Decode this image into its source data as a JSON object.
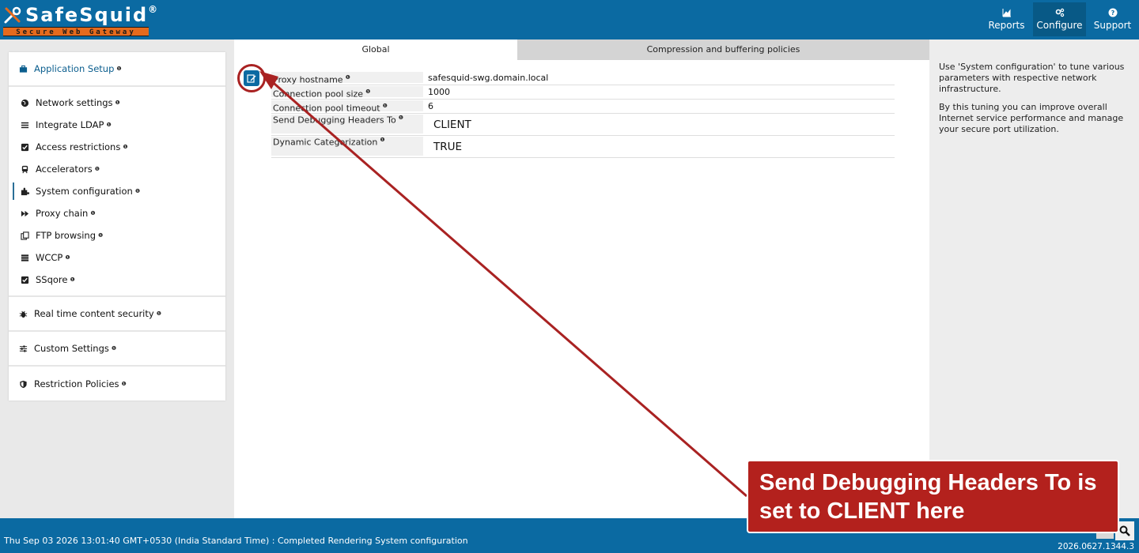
{
  "header": {
    "logo_title": "SafeSquid",
    "logo_reg": "®",
    "logo_subtitle": "Secure Web Gateway",
    "nav": [
      {
        "label": "Reports",
        "icon": "chart-icon"
      },
      {
        "label": "Configure",
        "icon": "cogs-icon",
        "active": true
      },
      {
        "label": "Support",
        "icon": "question-icon"
      }
    ]
  },
  "sidebar": {
    "app_setup": "Application Setup",
    "items": [
      {
        "label": "Network settings",
        "icon": "globe-icon"
      },
      {
        "label": "Integrate LDAP",
        "icon": "list-icon"
      },
      {
        "label": "Access restrictions",
        "icon": "checkbox-icon"
      },
      {
        "label": "Accelerators",
        "icon": "train-icon"
      },
      {
        "label": "System configuration",
        "icon": "puzzle-icon",
        "active": true
      },
      {
        "label": "Proxy chain",
        "icon": "fast-forward-icon"
      },
      {
        "label": "FTP browsing",
        "icon": "copy-icon"
      },
      {
        "label": "WCCP",
        "icon": "server-icon"
      },
      {
        "label": "SSqore",
        "icon": "checkbox-icon"
      }
    ],
    "realtime": "Real time content security",
    "custom": "Custom Settings",
    "restriction": "Restriction Policies"
  },
  "tabs": {
    "global": "Global",
    "compression": "Compression and buffering policies"
  },
  "config": {
    "rows": [
      {
        "label": "Proxy hostname",
        "value": "safesquid-swg.domain.local"
      },
      {
        "label": "Connection pool size",
        "value": "1000"
      },
      {
        "label": "Connection pool timeout",
        "value": "6"
      },
      {
        "label": "Send Debugging Headers To",
        "value": "CLIENT"
      },
      {
        "label": "Dynamic Categorization",
        "value": "TRUE"
      }
    ]
  },
  "help": {
    "p1": "Use 'System configuration' to tune various parameters with respective network infrastructure.",
    "p2": "By this tuning you can improve overall Internet service performance and manage your secure port utilization."
  },
  "footer": {
    "status": "Thu Sep 03 2026 13:01:40 GMT+0530 (India Standard Time) : Completed Rendering System configuration",
    "version": "2026.0627.1344.3"
  },
  "annotation": {
    "callout": "Send Debugging Headers To is set to CLIENT here"
  },
  "info_glyph": "❶",
  "colors": {
    "primary": "#0b6aa2",
    "accent": "#e56a1d",
    "annotation": "#b3211d"
  }
}
